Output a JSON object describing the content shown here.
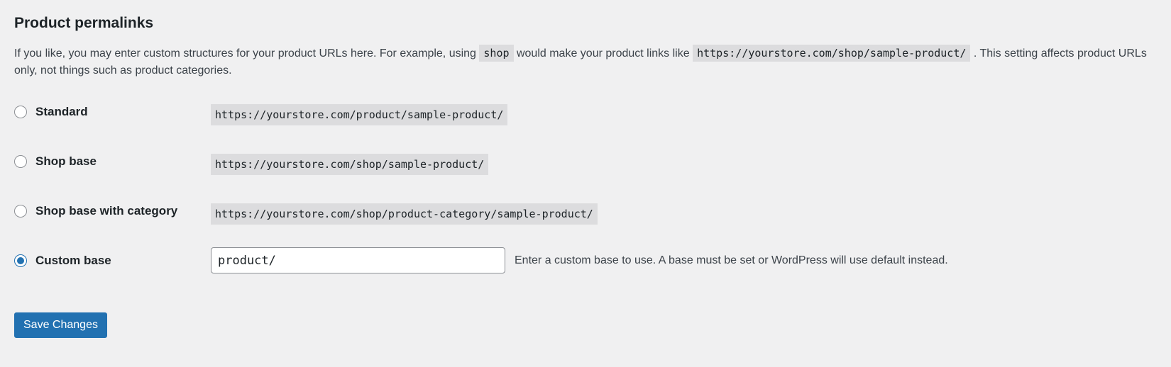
{
  "section": {
    "title": "Product permalinks",
    "description": {
      "part1": "If you like, you may enter custom structures for your product URLs here. For example, using",
      "code1": "shop",
      "part2": "would make your product links like",
      "code2": "https://yourstore.com/shop/sample-product/",
      "part3": ". This setting affects product URLs only, not things such as product categories."
    }
  },
  "options": [
    {
      "label": "Standard",
      "example": "https://yourstore.com/product/sample-product/",
      "checked": false
    },
    {
      "label": "Shop base",
      "example": "https://yourstore.com/shop/sample-product/",
      "checked": false
    },
    {
      "label": "Shop base with category",
      "example": "https://yourstore.com/shop/product-category/sample-product/",
      "checked": false
    },
    {
      "label": "Custom base",
      "input_value": "product/",
      "hint": "Enter a custom base to use. A base must be set or WordPress will use default instead.",
      "checked": true
    }
  ],
  "actions": {
    "save_label": "Save Changes"
  },
  "colors": {
    "accent": "#2271b1",
    "background": "#f0f0f1",
    "code_background": "#dcdcde"
  }
}
